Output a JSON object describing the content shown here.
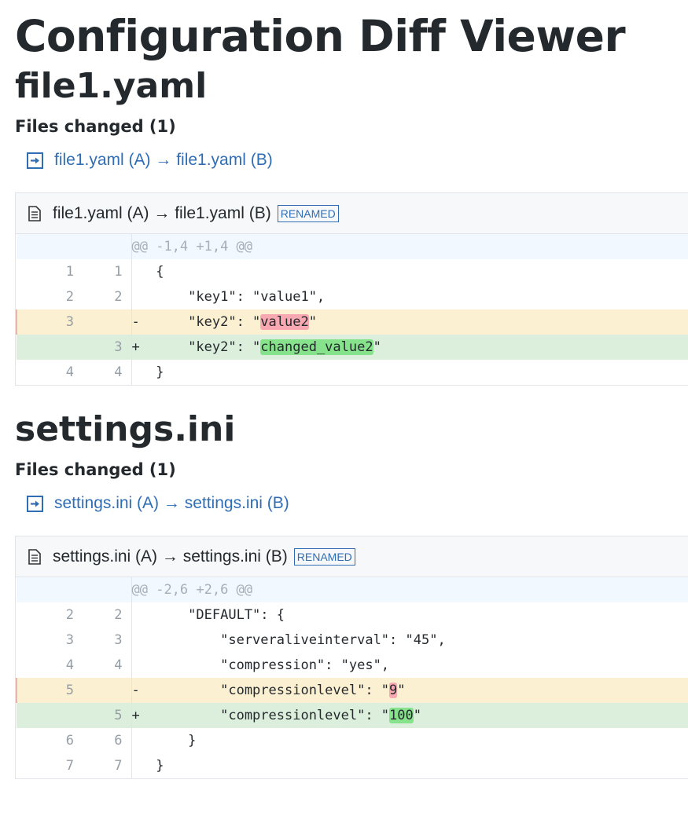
{
  "app": {
    "title": "Configuration Diff Viewer"
  },
  "sections": [
    {
      "title": "file1.yaml",
      "files_changed_label": "Files changed (1)",
      "file_link": "file1.yaml (A) → file1.yaml (B)",
      "diff_filename": "file1.yaml (A) → file1.yaml (B)",
      "badge": "RENAMED",
      "hunk": "@@ -1,4 +1,4 @@",
      "lines": [
        {
          "type": "context",
          "old": "1",
          "new": "1",
          "sign": " ",
          "pre": "{",
          "hl": "",
          "post": ""
        },
        {
          "type": "context",
          "old": "2",
          "new": "2",
          "sign": " ",
          "pre": "    \"key1\": \"value1\",",
          "hl": "",
          "post": ""
        },
        {
          "type": "del",
          "old": "3",
          "new": "",
          "sign": "-",
          "pre": "    \"key2\": \"",
          "hl": "value2",
          "post": "\""
        },
        {
          "type": "add",
          "old": "",
          "new": "3",
          "sign": "+",
          "pre": "    \"key2\": \"",
          "hl": "changed_value2",
          "post": "\""
        },
        {
          "type": "context",
          "old": "4",
          "new": "4",
          "sign": " ",
          "pre": "}",
          "hl": "",
          "post": ""
        }
      ]
    },
    {
      "title": "settings.ini",
      "files_changed_label": "Files changed (1)",
      "file_link": "settings.ini (A) → settings.ini (B)",
      "diff_filename": "settings.ini (A) → settings.ini (B)",
      "badge": "RENAMED",
      "hunk": "@@ -2,6 +2,6 @@",
      "lines": [
        {
          "type": "context",
          "old": "2",
          "new": "2",
          "sign": " ",
          "pre": "    \"DEFAULT\": {",
          "hl": "",
          "post": ""
        },
        {
          "type": "context",
          "old": "3",
          "new": "3",
          "sign": " ",
          "pre": "        \"serveraliveinterval\": \"45\",",
          "hl": "",
          "post": ""
        },
        {
          "type": "context",
          "old": "4",
          "new": "4",
          "sign": " ",
          "pre": "        \"compression\": \"yes\",",
          "hl": "",
          "post": ""
        },
        {
          "type": "del",
          "old": "5",
          "new": "",
          "sign": "-",
          "pre": "        \"compressionlevel\": \"",
          "hl": "9",
          "post": "\""
        },
        {
          "type": "add",
          "old": "",
          "new": "5",
          "sign": "+",
          "pre": "        \"compressionlevel\": \"",
          "hl": "100",
          "post": "\""
        },
        {
          "type": "context",
          "old": "6",
          "new": "6",
          "sign": " ",
          "pre": "    }",
          "hl": "",
          "post": ""
        },
        {
          "type": "context",
          "old": "7",
          "new": "7",
          "sign": " ",
          "pre": "}",
          "hl": "",
          "post": ""
        }
      ]
    }
  ]
}
